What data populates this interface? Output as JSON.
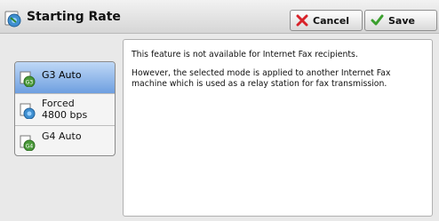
{
  "header": {
    "title": "Starting Rate",
    "cancel_label": "Cancel",
    "save_label": "Save"
  },
  "options": [
    {
      "label": "G3 Auto",
      "badge": "G3",
      "selected": true
    },
    {
      "label_line1": "Forced",
      "label_line2": "4800 bps",
      "selected": false
    },
    {
      "label": "G4 Auto",
      "badge": "G4",
      "selected": false
    }
  ],
  "message": {
    "line1": "This feature is not available for Internet Fax recipients.",
    "line2": "However, the selected mode is applied to another Internet Fax machine which is used as a relay station for fax transmission."
  },
  "colors": {
    "selected_gradient_top": "#bfd8f6",
    "selected_gradient_bottom": "#6e9fe0",
    "cancel_icon": "#d8232a",
    "save_icon": "#3ba02e"
  }
}
